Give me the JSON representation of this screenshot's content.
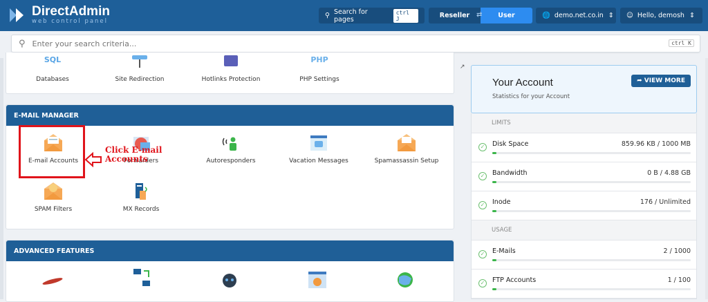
{
  "header": {
    "brand": "DirectAdmin",
    "tagline": "web control panel",
    "search_pages_label": "Search for pages",
    "search_pages_kbd": "ctrl J",
    "mode_reseller": "Reseller",
    "mode_user": "User",
    "domain": "demo.net.co.in",
    "greeting": "Hello, demosh",
    "colors": {
      "topbar": "#1e5f99",
      "active": "#2d8cf0"
    }
  },
  "search": {
    "placeholder": "Enter your search criteria...",
    "kbd": "ctrl K"
  },
  "top_items": [
    {
      "label": "Databases",
      "icon": "sql-icon"
    },
    {
      "label": "Site Redirection",
      "icon": "redirect-icon"
    },
    {
      "label": "Hotlinks Protection",
      "icon": "hotlink-icon"
    },
    {
      "label": "PHP Settings",
      "icon": "php-icon"
    }
  ],
  "email_manager": {
    "title": "E-MAIL MANAGER",
    "items": [
      {
        "label": "E-mail Accounts",
        "icon": "envelope-icon"
      },
      {
        "label": "Forwarders",
        "icon": "forward-envelope-icon"
      },
      {
        "label": "Autoresponders",
        "icon": "autoresponder-icon"
      },
      {
        "label": "Vacation Messages",
        "icon": "vacation-icon"
      },
      {
        "label": "Spamassassin Setup",
        "icon": "spamassassin-icon"
      },
      {
        "label": "SPAM Filters",
        "icon": "spam-filter-icon"
      },
      {
        "label": "MX Records",
        "icon": "mx-records-icon"
      }
    ]
  },
  "advanced": {
    "title": "ADVANCED FEATURES"
  },
  "annotation": {
    "text": "Click E-mail Accounts"
  },
  "account": {
    "title": "Your Account",
    "subtitle": "Statistics for your Account",
    "view_more": "VIEW MORE",
    "limits_label": "LIMITS",
    "usage_label": "USAGE",
    "limits": [
      {
        "name": "Disk Space",
        "value": "859.96 KB / 1000 MB",
        "fill": 0.02
      },
      {
        "name": "Bandwidth",
        "value": "0 B / 4.88 GB",
        "fill": 0.02
      },
      {
        "name": "Inode",
        "value": "176 / Unlimited",
        "fill": 0.02
      }
    ],
    "usage": [
      {
        "name": "E-Mails",
        "value": "2 / 1000",
        "fill": 0.02
      },
      {
        "name": "FTP Accounts",
        "value": "1 / 100",
        "fill": 0.02
      }
    ]
  }
}
